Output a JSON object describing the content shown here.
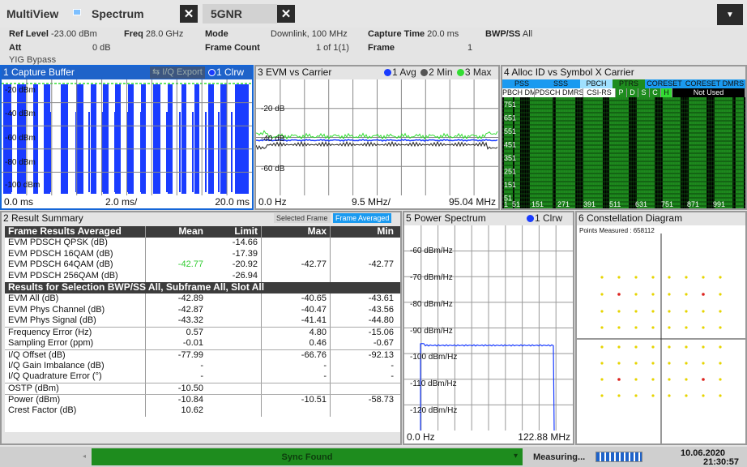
{
  "topbar": {
    "app_label": "MultiView",
    "tab1": "Spectrum",
    "tab2": "5GNR",
    "close": "✕",
    "menu": "▼"
  },
  "info": {
    "ref_level_label": "Ref Level",
    "ref_level": "-23.00 dBm",
    "freq_label": "Freq",
    "freq": "28.0 GHz",
    "mode_label": "Mode",
    "mode": "Downlink, 100 MHz",
    "capture_label": "Capture Time",
    "capture": "20.0 ms",
    "bwp_label": "BWP/SS",
    "bwp": "All",
    "att_label": "Att",
    "att": "0 dB",
    "frame_count_label": "Frame Count",
    "frame_count": "1 of 1(1)",
    "frame_label": "Frame",
    "frame": "1",
    "yig": "YIG Bypass"
  },
  "p1": {
    "title": "1 Capture Buffer",
    "iq_export": "I/Q Export",
    "legend": "1 Clrw",
    "yticks": [
      "-20 dBm",
      "-40 dBm",
      "-60 dBm",
      "-80 dBm",
      "-100 dBm"
    ],
    "x_start": "0.0 ms",
    "x_div": "2.0 ms/",
    "x_end": "20.0 ms"
  },
  "p3": {
    "title": "3 EVM vs Carrier",
    "legend1": "1 Avg",
    "legend2": "2 Min",
    "legend3": "3 Max",
    "yticks": [
      "-20 dB",
      "-40 dB",
      "-60 dB"
    ],
    "x_start": "0.0 Hz",
    "x_div": "9.5 MHz/",
    "x_end": "95.04 MHz"
  },
  "p4": {
    "title": "4 Alloc ID vs Symbol X Carrier",
    "legend_row1": [
      "PSS",
      "SSS",
      "PBCH",
      "PTRS",
      "CORESET",
      "CORESET DMRS"
    ],
    "legend_row2": [
      "PBCH DMRS",
      "PDSCH DMRS",
      "CSI-RS",
      "P",
      "D",
      "S",
      "C",
      "H",
      "Not Used"
    ],
    "yticks": [
      "751",
      "651",
      "551",
      "451",
      "351",
      "251",
      "151",
      "51"
    ],
    "xticks": [
      "151",
      "271",
      "391",
      "511",
      "631",
      "751",
      "871",
      "991"
    ],
    "y_first": "1",
    "x_first": "51"
  },
  "p2": {
    "title": "2 Result Summary",
    "btn_selected": "Selected Frame",
    "btn_averaged": "Frame Averaged",
    "header": [
      "Frame Results Averaged",
      "Mean",
      "Limit",
      "Max",
      "Min"
    ],
    "pdsch_rows": [
      {
        "label": "EVM PDSCH QPSK (dB)",
        "limit": "-14.66"
      },
      {
        "label": "EVM PDSCH 16QAM (dB)",
        "limit": "-17.39"
      },
      {
        "label": "EVM PDSCH 64QAM (dB)",
        "limit": "-20.92"
      },
      {
        "label": "EVM PDSCH 256QAM (dB)",
        "limit": "-26.94"
      }
    ],
    "pdsch_mean": "-42.77",
    "pdsch_max": "-42.77",
    "pdsch_min": "-42.77",
    "selection_header": "Results for Selection  BWP/SS All,  Subframe All,  Slot All",
    "rows": [
      {
        "label": "EVM All (dB)",
        "mean": "-42.89",
        "max": "-40.65",
        "min": "-43.61"
      },
      {
        "label": "EVM Phys Channel (dB)",
        "mean": "-42.87",
        "max": "-40.47",
        "min": "-43.56"
      },
      {
        "label": "EVM Phys Signal (dB)",
        "mean": "-43.32",
        "max": "-41.41",
        "min": "-44.80"
      },
      {
        "label": "Frequency Error (Hz)",
        "mean": "0.57",
        "max": "4.80",
        "min": "-15.06"
      },
      {
        "label": "Sampling Error (ppm)",
        "mean": "-0.01",
        "max": "0.46",
        "min": "-0.67"
      },
      {
        "label": "I/Q Offset (dB)",
        "mean": "-77.99",
        "max": "-66.76",
        "min": "-92.13"
      },
      {
        "label": "I/Q Gain Imbalance (dB)",
        "mean": "-",
        "max": "-",
        "min": "-"
      },
      {
        "label": "I/Q Quadrature Error (°)",
        "mean": "-",
        "max": "-",
        "min": "-"
      },
      {
        "label": "OSTP (dBm)",
        "mean": "-10.50",
        "max": "",
        "min": ""
      },
      {
        "label": "Power (dBm)",
        "mean": "-10.84",
        "max": "-10.51",
        "min": "-58.73"
      },
      {
        "label": "Crest Factor (dB)",
        "mean": "10.62",
        "max": "",
        "min": ""
      }
    ]
  },
  "p5": {
    "title": "5 Power Spectrum",
    "legend": "1 Clrw",
    "yticks": [
      "-60 dBm/Hz",
      "-70 dBm/Hz",
      "-80 dBm/Hz",
      "-90 dBm/Hz",
      "-100 dBm/Hz",
      "-110 dBm/Hz",
      "-120 dBm/Hz"
    ],
    "x_start": "0.0 Hz",
    "x_end": "122.88 MHz"
  },
  "p6": {
    "title": "6 Constellation Diagram",
    "points_label": "Points Measured : 658112"
  },
  "status": {
    "sync": "Sync Found",
    "measuring": "Measuring...",
    "date": "10.06.2020",
    "time": "21:30:57"
  },
  "colors": {
    "accent_blue": "#1f63c9",
    "trace_blue": "#1a3cff",
    "min_green": "#33dd33",
    "grid_alloc_green": "#1e8c1e",
    "sync_green": "#1e8c1e"
  }
}
